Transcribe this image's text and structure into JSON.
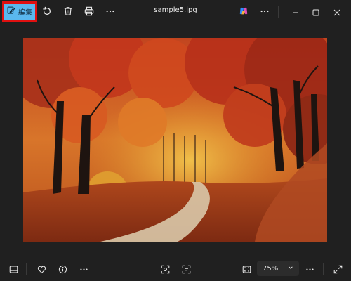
{
  "toolbar": {
    "edit_label": "編集",
    "title": "sample5.jpg"
  },
  "icons": {
    "edit": "edit-icon",
    "rotate": "rotate-icon",
    "delete": "trash-icon",
    "print": "print-icon",
    "more": "more-icon",
    "copilot": "copilot-icon",
    "minimize": "minimize-icon",
    "maximize": "maximize-icon",
    "close": "close-icon",
    "filmstrip": "filmstrip-icon",
    "favorite": "heart-icon",
    "info": "info-icon",
    "visual_search": "visual-search-icon",
    "text_scan": "text-scan-icon",
    "fit": "fit-to-window-icon",
    "fullscreen": "fullscreen-icon"
  },
  "bottom": {
    "zoom_value": "75%"
  },
  "colors": {
    "background": "#202020",
    "edit_button_bg": "#5ab8ee",
    "highlight_border": "#e01010"
  }
}
